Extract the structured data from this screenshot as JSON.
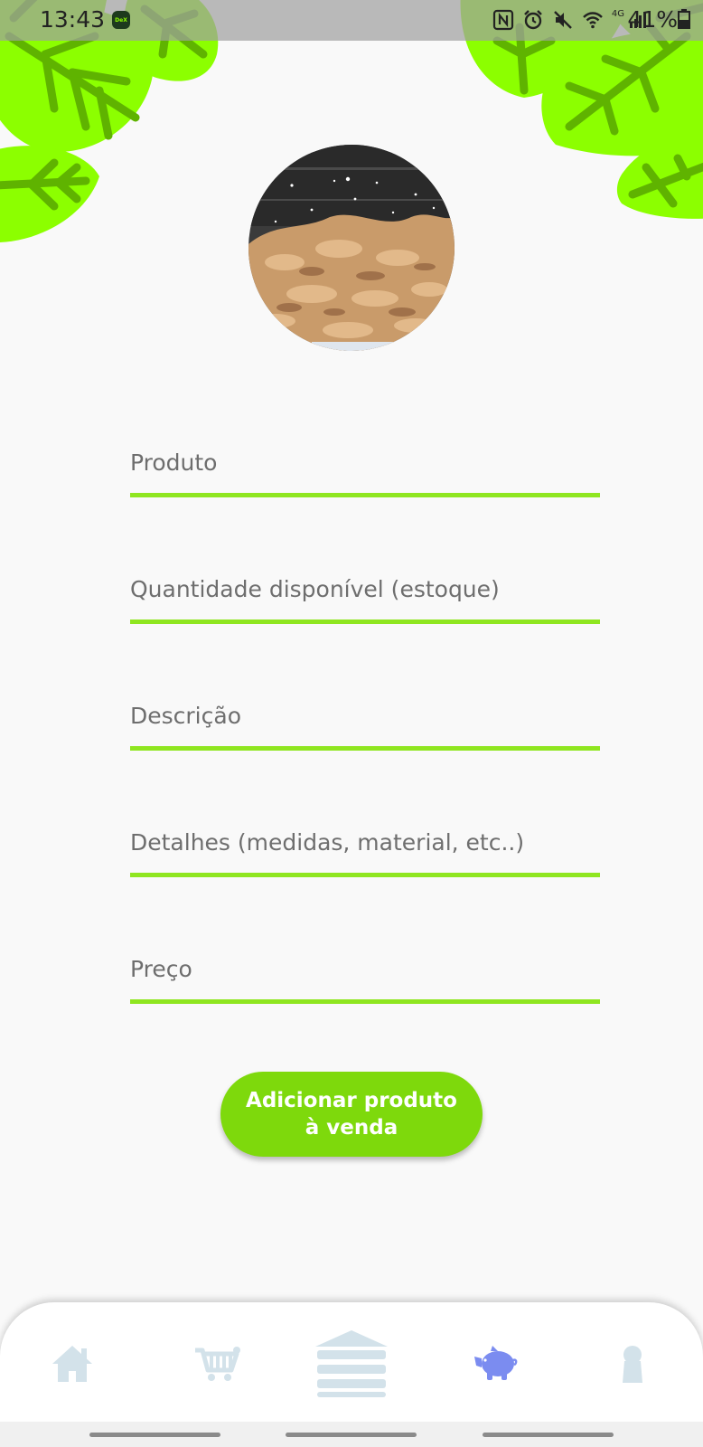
{
  "status_bar": {
    "time": "13:43",
    "dex_badge": "DeX",
    "network": "4G",
    "battery": "41%"
  },
  "product_image": {
    "description": "product-photo"
  },
  "form": {
    "product_placeholder": "Produto",
    "quantity_placeholder": "Quantidade disponível (estoque)",
    "description_placeholder": "Descrição",
    "details_placeholder": "Detalhes (medidas, material, etc..)",
    "price_placeholder": "Preço"
  },
  "submit_button": {
    "label": "Adicionar produto\nà venda"
  },
  "bottom_nav": {
    "items": [
      {
        "icon": "home-icon",
        "active": false
      },
      {
        "icon": "cart-icon",
        "active": false
      },
      {
        "icon": "stack-icon",
        "active": false
      },
      {
        "icon": "piggy-bank-icon",
        "active": true
      },
      {
        "icon": "person-icon",
        "active": false
      }
    ]
  },
  "colors": {
    "accent_green": "#8fe620",
    "button_green": "#7ed90c",
    "leaf_green": "#8cff00",
    "leaf_vein": "#5fb300",
    "nav_inactive": "#d3e2ea",
    "nav_active": "#7b8cf0",
    "background": "#f9f9f9"
  }
}
